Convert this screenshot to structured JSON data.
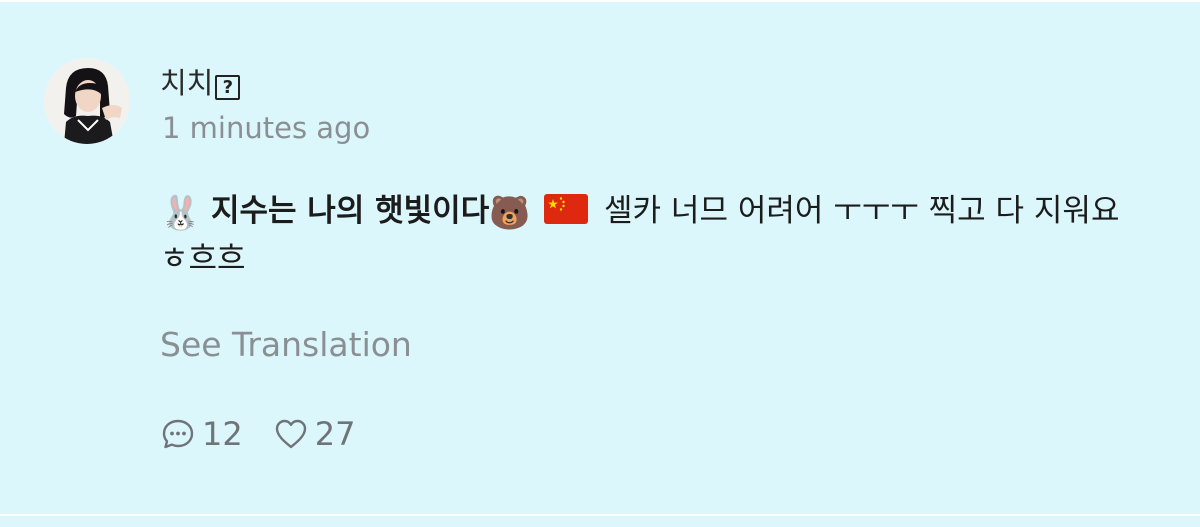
{
  "comment": {
    "author": "치치",
    "author_unknown_glyph": "?",
    "timestamp": "1 minutes ago",
    "body": {
      "emoji_before": "🐰",
      "nickname": "지수는 나의 햇빛이다",
      "emoji_after": "🐻",
      "flag_icon": "china-flag-icon",
      "text": "셀카 너므 어려어 ㅜㅜㅜ 찍고 다 지워요 ㅎ흐흐"
    },
    "translate_label": "See Translation",
    "reply_count": "12",
    "like_count": "27"
  },
  "icons": {
    "reply": "speech-bubble-icon",
    "like": "heart-outline-icon"
  },
  "colors": {
    "background": "#dcf7fb",
    "secondary_text": "#8a8f93",
    "primary_text": "#1c1c1c"
  }
}
